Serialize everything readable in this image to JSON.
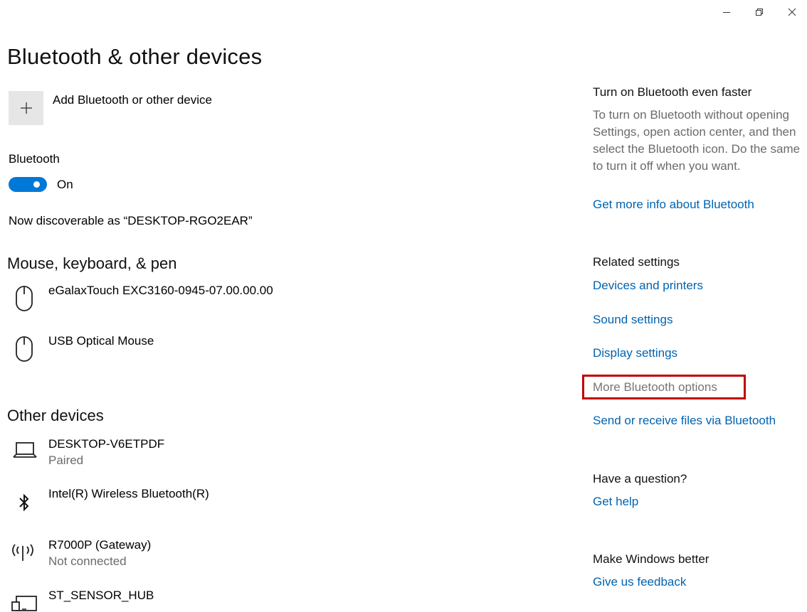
{
  "window": {
    "minimize_icon": "minimize-icon",
    "restore_icon": "restore-icon",
    "close_icon": "close-icon"
  },
  "page": {
    "title": "Bluetooth & other devices"
  },
  "add_device": {
    "label": "Add Bluetooth or other device",
    "icon": "plus-icon"
  },
  "bluetooth": {
    "label": "Bluetooth",
    "toggle_state": "On",
    "toggle_on": true,
    "discoverable": "Now discoverable as “DESKTOP-RGO2EAR”"
  },
  "mouse_section": {
    "title": "Mouse, keyboard, & pen",
    "devices": [
      {
        "name": "eGalaxTouch EXC3160-0945-07.00.00.00",
        "icon": "mouse-icon"
      },
      {
        "name": "USB Optical Mouse",
        "icon": "mouse-icon"
      }
    ]
  },
  "other_section": {
    "title": "Other devices",
    "devices": [
      {
        "name": "DESKTOP-V6ETPDF",
        "status": "Paired",
        "icon": "laptop-icon"
      },
      {
        "name": "Intel(R) Wireless Bluetooth(R)",
        "icon": "bluetooth-icon"
      },
      {
        "name": "R7000P (Gateway)",
        "status": "Not connected",
        "icon": "wireless-icon"
      },
      {
        "name": "ST_SENSOR_HUB",
        "icon": "sensor-device-icon"
      }
    ]
  },
  "sidebar": {
    "faster": {
      "heading": "Turn on Bluetooth even faster",
      "text": "To turn on Bluetooth without opening Settings, open action center, and then select the Bluetooth icon. Do the same to turn it off when you want.",
      "link": "Get more info about Bluetooth"
    },
    "related": {
      "heading": "Related settings",
      "links": [
        "Devices and printers",
        "Sound settings",
        "Display settings",
        "More Bluetooth options",
        "Send or receive files via Bluetooth"
      ]
    },
    "question": {
      "heading": "Have a question?",
      "link": "Get help"
    },
    "better": {
      "heading": "Make Windows better",
      "link": "Give us feedback"
    }
  },
  "colors": {
    "accent": "#0078d7",
    "link": "#0063b1",
    "highlight_border": "#c00000"
  }
}
